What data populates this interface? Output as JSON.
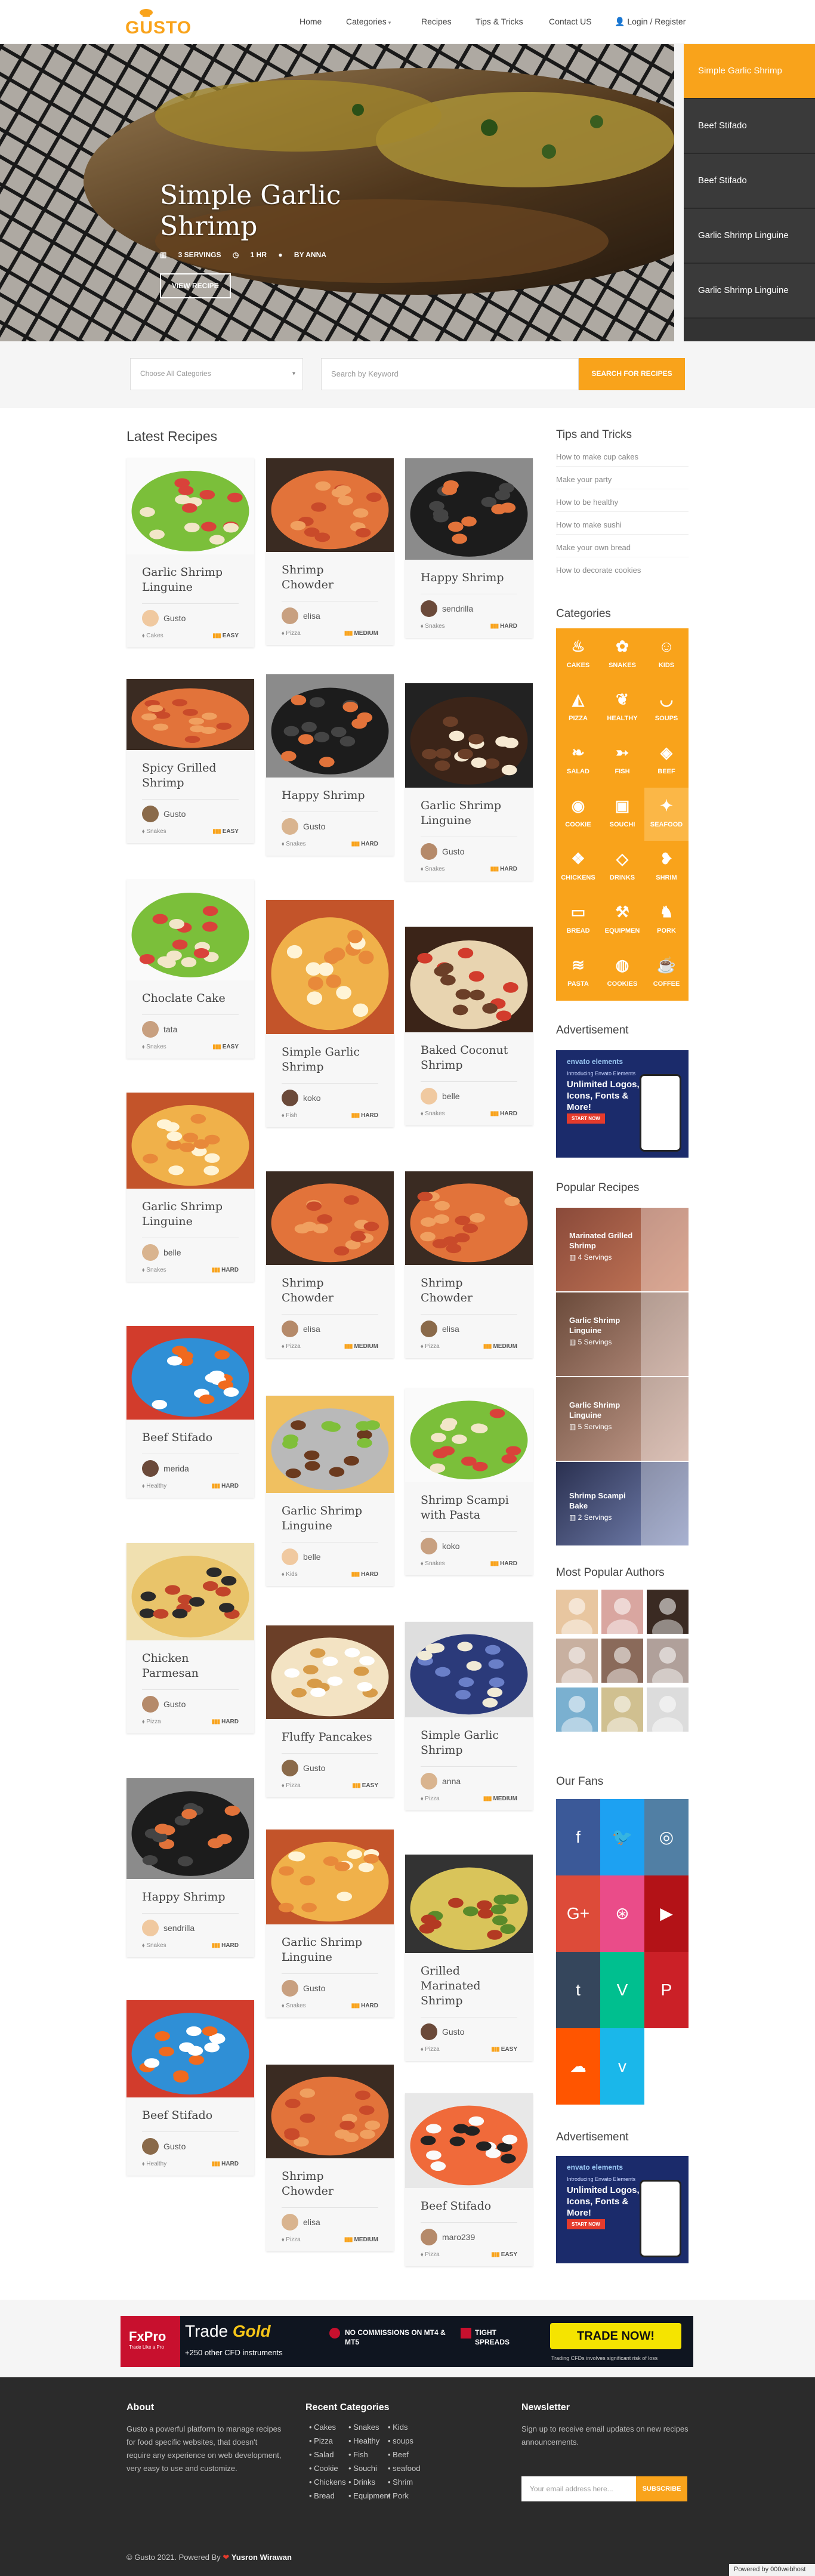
{
  "header": {
    "logo_text": "GUSTO",
    "nav": [
      {
        "label": "Home"
      },
      {
        "label": "Categories"
      },
      {
        "label": "Recipes"
      },
      {
        "label": "Tips & Tricks"
      },
      {
        "label": "Contact US"
      },
      {
        "label": "Login / Register"
      }
    ]
  },
  "hero": {
    "title": "Simple Garlic Shrimp",
    "servings": "3 SERVINGS",
    "time": "1 HR",
    "by": "BY ANNA",
    "button": "VIEW RECIPE"
  },
  "slides": [
    {
      "label": "Simple Garlic Shrimp"
    },
    {
      "label": "Beef Stifado"
    },
    {
      "label": "Beef Stifado"
    },
    {
      "label": "Garlic Shrimp Linguine"
    },
    {
      "label": "Garlic Shrimp Linguine"
    }
  ],
  "search": {
    "category_placeholder": "Choose All Categories",
    "keyword_placeholder": "Search by Keyword",
    "button": "SEARCH FOR RECIPES"
  },
  "latest": {
    "title": "Latest Recipes",
    "cards": [
      {
        "title": "Garlic Shrimp Linguine",
        "author": "Gusto",
        "category": "Cakes",
        "level": "EASY"
      },
      {
        "title": "Spicy Grilled Shrimp",
        "author": "Gusto",
        "category": "Snakes",
        "level": "EASY"
      },
      {
        "title": "Choclate Cake",
        "author": "tata",
        "category": "Snakes",
        "level": "EASY"
      },
      {
        "title": "Garlic Shrimp Linguine",
        "author": "belle",
        "category": "Snakes",
        "level": "HARD"
      },
      {
        "title": "Beef Stifado",
        "author": "merida",
        "category": "Healthy",
        "level": "HARD"
      },
      {
        "title": "Chicken Parmesan",
        "author": "Gusto",
        "category": "Pizza",
        "level": "HARD"
      },
      {
        "title": "Happy Shrimp",
        "author": "sendrilla",
        "category": "Snakes",
        "level": "HARD"
      },
      {
        "title": "Beef Stifado",
        "author": "Gusto",
        "category": "Healthy",
        "level": "HARD"
      },
      {
        "title": "Shrimp Chowder",
        "author": "elisa",
        "category": "Pizza",
        "level": "MEDIUM"
      },
      {
        "title": "Happy Shrimp",
        "author": "Gusto",
        "category": "Snakes",
        "level": "HARD"
      },
      {
        "title": "Simple Garlic Shrimp",
        "author": "koko",
        "category": "Fish",
        "level": "HARD"
      },
      {
        "title": "Shrimp Chowder",
        "author": "elisa",
        "category": "Pizza",
        "level": "MEDIUM"
      },
      {
        "title": "Garlic Shrimp Linguine",
        "author": "belle",
        "category": "Kids",
        "level": "HARD"
      },
      {
        "title": "Fluffy Pancakes",
        "author": "Gusto",
        "category": "Pizza",
        "level": "EASY"
      },
      {
        "title": "Garlic Shrimp Linguine",
        "author": "Gusto",
        "category": "Snakes",
        "level": "HARD"
      },
      {
        "title": "Shrimp Chowder",
        "author": "elisa",
        "category": "Pizza",
        "level": "MEDIUM"
      },
      {
        "title": "Happy Shrimp",
        "author": "sendrilla",
        "category": "Snakes",
        "level": "HARD"
      },
      {
        "title": "Garlic Shrimp Linguine",
        "author": "Gusto",
        "category": "Snakes",
        "level": "HARD"
      },
      {
        "title": "Baked Coconut Shrimp",
        "author": "belle",
        "category": "Snakes",
        "level": "HARD"
      },
      {
        "title": "Shrimp Chowder",
        "author": "elisa",
        "category": "Pizza",
        "level": "MEDIUM"
      },
      {
        "title": "Shrimp Scampi with Pasta",
        "author": "koko",
        "category": "Snakes",
        "level": "HARD"
      },
      {
        "title": "Simple Garlic Shrimp",
        "author": "anna",
        "category": "Pizza",
        "level": "MEDIUM"
      },
      {
        "title": "Grilled Marinated Shrimp",
        "author": "Gusto",
        "category": "Pizza",
        "level": "EASY"
      },
      {
        "title": "Beef Stifado",
        "author": "maro239",
        "category": "Pizza",
        "level": "EASY"
      }
    ]
  },
  "sidebar": {
    "tips_title": "Tips and Tricks",
    "tips": [
      "How to make cup cakes",
      "Make your party",
      "How to be healthy",
      "How to make sushi",
      "Make your own bread",
      "How to decorate cookies"
    ],
    "categories_title": "Categories",
    "categories": [
      {
        "label": "CAKES",
        "icon": "cake-icon",
        "glyph": "♨"
      },
      {
        "label": "SNAKES",
        "icon": "snack-icon",
        "glyph": "✿"
      },
      {
        "label": "KIDS",
        "icon": "kids-icon",
        "glyph": "☺"
      },
      {
        "label": "PIZZA",
        "icon": "pizza-icon",
        "glyph": "◭"
      },
      {
        "label": "HEALTHY",
        "icon": "healthy-icon",
        "glyph": "❦"
      },
      {
        "label": "SOUPS",
        "icon": "soup-icon",
        "glyph": "◡"
      },
      {
        "label": "SALAD",
        "icon": "salad-icon",
        "glyph": "❧"
      },
      {
        "label": "FISH",
        "icon": "fish-icon",
        "glyph": "➳"
      },
      {
        "label": "BEEF",
        "icon": "beef-icon",
        "glyph": "◈"
      },
      {
        "label": "COOKIE",
        "icon": "cookie-icon",
        "glyph": "◉"
      },
      {
        "label": "SOUCHI",
        "icon": "sushi-icon",
        "glyph": "▣"
      },
      {
        "label": "SEAFOOD",
        "icon": "seafood-icon",
        "glyph": "✦"
      },
      {
        "label": "CHICKENS",
        "icon": "chicken-icon",
        "glyph": "❖"
      },
      {
        "label": "DRINKS",
        "icon": "drink-icon",
        "glyph": "◇"
      },
      {
        "label": "SHRIM",
        "icon": "shrimp-icon",
        "glyph": "❥"
      },
      {
        "label": "BREAD",
        "icon": "bread-icon",
        "glyph": "▭"
      },
      {
        "label": "EQUIPMEN",
        "icon": "equipment-icon",
        "glyph": "⚒"
      },
      {
        "label": "PORK",
        "icon": "pork-icon",
        "glyph": "♞"
      },
      {
        "label": "PASTA",
        "icon": "pasta-icon",
        "glyph": "≋"
      },
      {
        "label": "COOKIES",
        "icon": "cookies-icon",
        "glyph": "◍"
      },
      {
        "label": "COFFEE",
        "icon": "coffee-icon",
        "glyph": "☕"
      }
    ],
    "advertisement_title": "Advertisement",
    "ad": {
      "brand": "envato elements",
      "small": "Introducing Envato Elements",
      "big": "Unlimited Logos, Icons, Fonts & More!",
      "button": "START NOW"
    },
    "popular_title": "Popular Recipes",
    "popular": [
      {
        "title": "Marinated Grilled Shrimp",
        "servings": "4 Servings"
      },
      {
        "title": "Garlic Shrimp Linguine",
        "servings": "5 Servings"
      },
      {
        "title": "Garlic Shrimp Linguine",
        "servings": "5 Servings"
      },
      {
        "title": "Shrimp Scampi Bake",
        "servings": "2 Servings"
      }
    ],
    "authors_title": "Most Popular Authors",
    "fans_title": "Our Fans",
    "fans": [
      {
        "icon": "facebook-icon",
        "glyph": "f",
        "color": "#3b5998"
      },
      {
        "icon": "twitter-icon",
        "glyph": "🐦",
        "color": "#1da1f2"
      },
      {
        "icon": "instagram-icon",
        "glyph": "◎",
        "color": "#517fa4"
      },
      {
        "icon": "google-plus-icon",
        "glyph": "G+",
        "color": "#dd4b39"
      },
      {
        "icon": "dribbble-icon",
        "glyph": "⊛",
        "color": "#ea4c89"
      },
      {
        "icon": "youtube-icon",
        "glyph": "▶",
        "color": "#b31217"
      },
      {
        "icon": "tumblr-icon",
        "glyph": "t",
        "color": "#35465c"
      },
      {
        "icon": "vine-icon",
        "glyph": "V",
        "color": "#00bf8f"
      },
      {
        "icon": "pinterest-icon",
        "glyph": "P",
        "color": "#cb2027"
      },
      {
        "icon": "soundcloud-icon",
        "glyph": "☁",
        "color": "#ff5500"
      },
      {
        "icon": "vimeo-icon",
        "glyph": "v",
        "color": "#1ab7ea"
      }
    ],
    "advertisement2_title": "Advertisement"
  },
  "banner": {
    "brand": "FxPro",
    "brand_sub": "Trade Like a Pro",
    "trade": "Trade",
    "gold": "Gold",
    "instruments": "+250 other CFD instruments",
    "commission": "NO COMMISSIONS ON MT4 & MT5",
    "spreads": "TIGHT SPREADS",
    "button": "TRADE NOW!",
    "risk": "Trading CFDs involves significant risk of loss"
  },
  "footer": {
    "about_title": "About",
    "about_text": "Gusto a powerful platform to manage recipes for food specific websites, that doesn't require any experience on web development, very easy to use and customize.",
    "recent_title": "Recent Categories",
    "recent": [
      [
        "Cakes",
        "Snakes",
        "Kids"
      ],
      [
        "Pizza",
        "Healthy",
        "soups"
      ],
      [
        "Salad",
        "Fish",
        "Beef"
      ],
      [
        "Cookie",
        "Souchi",
        "seafood"
      ],
      [
        "Chickens",
        "Drinks",
        "Shrim"
      ],
      [
        "Bread",
        "Equipment",
        "Pork"
      ]
    ],
    "newsletter_title": "Newsletter",
    "newsletter_text": "Sign up to receive email updates on new recipes announcements.",
    "email_placeholder": "Your email address here...",
    "subscribe": "SUBSCRIBE",
    "copyright": "© Gusto 2021. Powered By",
    "powered_by": "Yusron Wirawan",
    "host_badge": "Powered by 000webhost"
  },
  "colors": {
    "accent": "#f9a31b",
    "dark": "#2b2b2b"
  }
}
